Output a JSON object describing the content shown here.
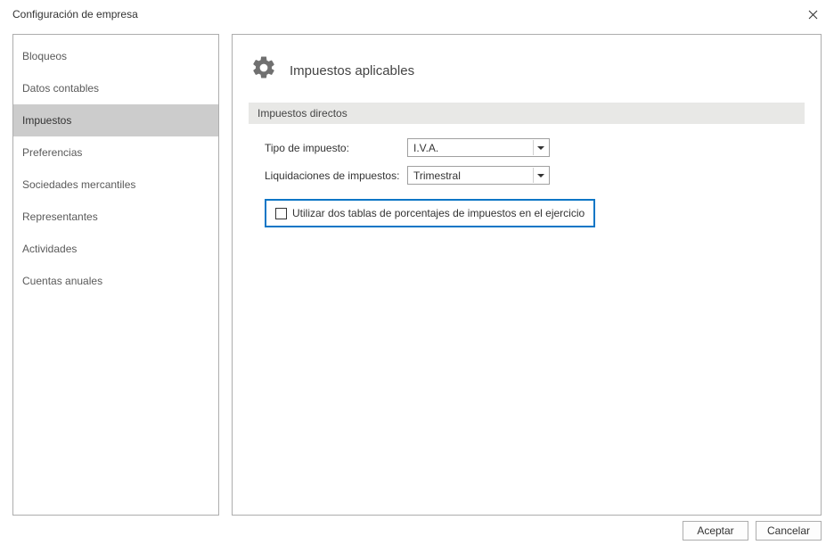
{
  "window": {
    "title": "Configuración de empresa"
  },
  "sidebar": {
    "items": [
      {
        "label": "Bloqueos"
      },
      {
        "label": "Datos contables"
      },
      {
        "label": "Impuestos"
      },
      {
        "label": "Preferencias"
      },
      {
        "label": "Sociedades mercantiles"
      },
      {
        "label": "Representantes"
      },
      {
        "label": "Actividades"
      },
      {
        "label": "Cuentas anuales"
      }
    ],
    "selected_index": 2
  },
  "main": {
    "section_title": "Impuestos aplicables",
    "group_title": "Impuestos directos",
    "fields": {
      "tipo_label": "Tipo de impuesto:",
      "tipo_value": "I.V.A.",
      "liq_label": "Liquidaciones de impuestos:",
      "liq_value": "Trimestral"
    },
    "checkbox_label": "Utilizar dos tablas de porcentajes de impuestos en el ejercicio"
  },
  "footer": {
    "accept": "Aceptar",
    "cancel": "Cancelar"
  }
}
